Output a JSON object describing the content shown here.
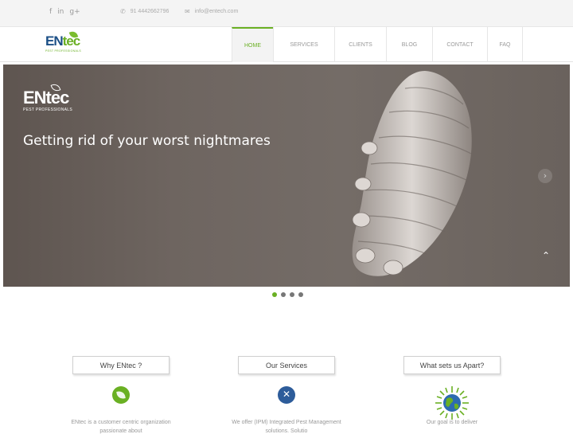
{
  "topbar": {
    "social": [
      {
        "icon": "facebook-icon",
        "glyph": "f"
      },
      {
        "icon": "linkedin-icon",
        "glyph": "in"
      },
      {
        "icon": "google-plus-icon",
        "glyph": "g+"
      }
    ],
    "phone": "91 4442662796",
    "email": "info@entech.com"
  },
  "brand": {
    "name_a": "EN",
    "name_b": "tec",
    "tagline": "PEST PROFESSIONALS"
  },
  "nav": {
    "items": [
      {
        "label": "Home",
        "active": true
      },
      {
        "label": "Services",
        "active": false
      },
      {
        "label": "Clients",
        "active": false
      },
      {
        "label": "Blog",
        "active": false
      },
      {
        "label": "Contact",
        "active": false
      },
      {
        "label": "FAQ",
        "active": false
      }
    ]
  },
  "slider": {
    "logo_a": "ENtec",
    "logo_tag": "PEST PROFESSIONALS",
    "headline": "Getting rid of your worst nightmares",
    "next_glyph": "›",
    "scroll_top_glyph": "⌃",
    "slide_count": 4,
    "active_slide": 1
  },
  "features": [
    {
      "title": "Why ENtec ?",
      "icon": "leaf-icon",
      "text": "ENtec is a customer centric organization passionate about"
    },
    {
      "title": "Our Services",
      "icon": "services-icon",
      "text": "We offer (IPM) Integrated Pest Management solutions. Solutio"
    },
    {
      "title": "What sets us Apart?",
      "icon": "globe-icon",
      "text": "Our goal is to deliver"
    }
  ],
  "colors": {
    "brand_green": "#6ab023",
    "brand_blue": "#1b4f86"
  }
}
